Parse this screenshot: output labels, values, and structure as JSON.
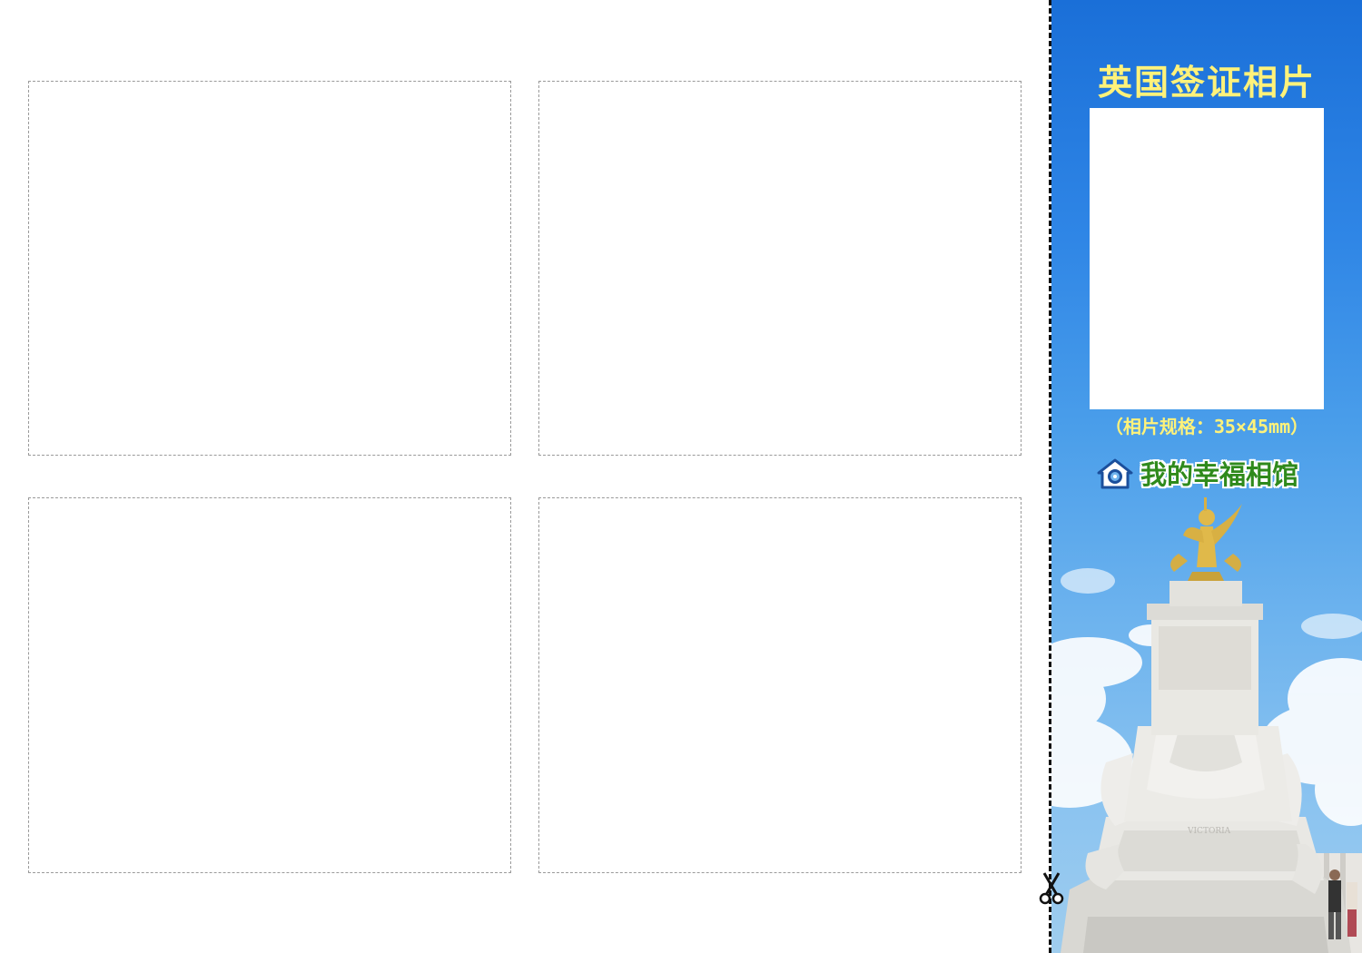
{
  "sheet": {
    "slots": [
      {
        "label": ""
      },
      {
        "label": ""
      },
      {
        "label": ""
      },
      {
        "label": ""
      }
    ],
    "cut_icon": "scissors-icon"
  },
  "panel": {
    "title": "英国签证相片",
    "spec": "（相片规格：35×45mm）",
    "brand_name": "我的幸福相馆",
    "brand_icon": "house-camera-icon",
    "background": "monument-photo",
    "colors": {
      "sky_top": "#1a6fd8",
      "sky_bottom": "#9fcdee",
      "title": "#fff27a",
      "brand": "#2f8a1c"
    }
  }
}
